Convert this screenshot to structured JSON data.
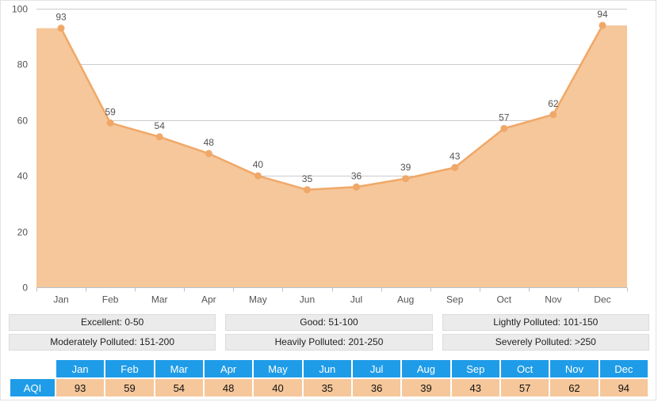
{
  "chart_data": {
    "type": "area",
    "title": "",
    "xlabel": "",
    "ylabel": "",
    "categories": [
      "Jan",
      "Feb",
      "Mar",
      "Apr",
      "May",
      "Jun",
      "Jul",
      "Aug",
      "Sep",
      "Oct",
      "Nov",
      "Dec"
    ],
    "values": [
      93,
      59,
      54,
      48,
      40,
      35,
      36,
      39,
      43,
      57,
      62,
      94
    ],
    "series": [
      {
        "name": "AQI",
        "values": [
          93,
          59,
          54,
          48,
          40,
          35,
          36,
          39,
          43,
          57,
          62,
          94
        ]
      }
    ],
    "ylim": [
      0,
      100
    ],
    "yticks": [
      0,
      20,
      40,
      60,
      80,
      100
    ],
    "ytick_labels": [
      "0",
      "20",
      "40",
      "60",
      "80",
      "100"
    ],
    "grid": true,
    "legend_position": "below-chart",
    "show_data_labels": true,
    "colors": {
      "line": "#f0a868",
      "fill": "#f5c79a",
      "marker": "#f0a868",
      "grid": "#cccccc",
      "axis": "#b6c2cc",
      "tick_text": "#545454",
      "table_header": "#1f9ce8",
      "table_value_bg": "#f5c79a"
    }
  },
  "legend": {
    "row1": [
      {
        "label": "Excellent: 0-50"
      },
      {
        "label": "Good: 51-100"
      },
      {
        "label": "Lightly Polluted: 101-150"
      }
    ],
    "row2": [
      {
        "label": "Moderately Polluted: 151-200"
      },
      {
        "label": "Heavily Polluted: 201-250"
      },
      {
        "label": "Severely Polluted: >250"
      }
    ]
  },
  "table": {
    "corner_label": "",
    "row_label": "AQI",
    "headers": [
      "Jan",
      "Feb",
      "Mar",
      "Apr",
      "May",
      "Jun",
      "Jul",
      "Aug",
      "Sep",
      "Oct",
      "Nov",
      "Dec"
    ],
    "values": [
      "93",
      "59",
      "54",
      "48",
      "40",
      "35",
      "36",
      "39",
      "43",
      "57",
      "62",
      "94"
    ]
  }
}
